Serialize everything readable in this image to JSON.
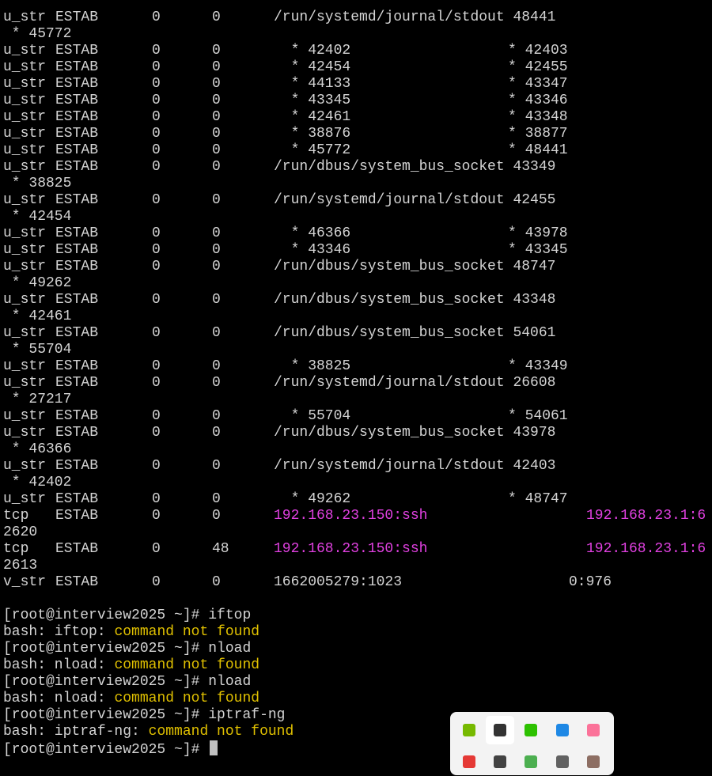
{
  "terminal": {
    "rows": [
      {
        "cols": [
          "u_str",
          "ESTAB",
          "0",
          "0",
          "/run/systemd/journal/stdout 48441"
        ]
      },
      {
        "cols": [
          " * 45772"
        ]
      },
      {
        "cols": [
          "u_str",
          "ESTAB",
          "0",
          "0",
          "  * 42402",
          "* 42403"
        ]
      },
      {
        "cols": [
          "u_str",
          "ESTAB",
          "0",
          "0",
          "  * 42454",
          "* 42455"
        ]
      },
      {
        "cols": [
          "u_str",
          "ESTAB",
          "0",
          "0",
          "  * 44133",
          "* 43347"
        ]
      },
      {
        "cols": [
          "u_str",
          "ESTAB",
          "0",
          "0",
          "  * 43345",
          "* 43346"
        ]
      },
      {
        "cols": [
          "u_str",
          "ESTAB",
          "0",
          "0",
          "  * 42461",
          "* 43348"
        ]
      },
      {
        "cols": [
          "u_str",
          "ESTAB",
          "0",
          "0",
          "  * 38876",
          "* 38877"
        ]
      },
      {
        "cols": [
          "u_str",
          "ESTAB",
          "0",
          "0",
          "  * 45772",
          "* 48441"
        ]
      },
      {
        "cols": [
          "u_str",
          "ESTAB",
          "0",
          "0",
          "/run/dbus/system_bus_socket 43349"
        ]
      },
      {
        "cols": [
          " * 38825"
        ]
      },
      {
        "cols": [
          "u_str",
          "ESTAB",
          "0",
          "0",
          "/run/systemd/journal/stdout 42455"
        ]
      },
      {
        "cols": [
          " * 42454"
        ]
      },
      {
        "cols": [
          "u_str",
          "ESTAB",
          "0",
          "0",
          "  * 46366",
          "* 43978"
        ]
      },
      {
        "cols": [
          "u_str",
          "ESTAB",
          "0",
          "0",
          "  * 43346",
          "* 43345"
        ]
      },
      {
        "cols": [
          "u_str",
          "ESTAB",
          "0",
          "0",
          "/run/dbus/system_bus_socket 48747"
        ]
      },
      {
        "cols": [
          " * 49262"
        ]
      },
      {
        "cols": [
          "u_str",
          "ESTAB",
          "0",
          "0",
          "/run/dbus/system_bus_socket 43348"
        ]
      },
      {
        "cols": [
          " * 42461"
        ]
      },
      {
        "cols": [
          "u_str",
          "ESTAB",
          "0",
          "0",
          "/run/dbus/system_bus_socket 54061"
        ]
      },
      {
        "cols": [
          " * 55704"
        ]
      },
      {
        "cols": [
          "u_str",
          "ESTAB",
          "0",
          "0",
          "  * 38825",
          "* 43349"
        ]
      },
      {
        "cols": [
          "u_str",
          "ESTAB",
          "0",
          "0",
          "/run/systemd/journal/stdout 26608"
        ]
      },
      {
        "cols": [
          " * 27217"
        ]
      },
      {
        "cols": [
          "u_str",
          "ESTAB",
          "0",
          "0",
          "  * 55704",
          "* 54061"
        ]
      },
      {
        "cols": [
          "u_str",
          "ESTAB",
          "0",
          "0",
          "/run/dbus/system_bus_socket 43978"
        ]
      },
      {
        "cols": [
          " * 46366"
        ]
      },
      {
        "cols": [
          "u_str",
          "ESTAB",
          "0",
          "0",
          "/run/systemd/journal/stdout 42403"
        ]
      },
      {
        "cols": [
          " * 42402"
        ]
      },
      {
        "cols": [
          "u_str",
          "ESTAB",
          "0",
          "0",
          "  * 49262",
          "* 48747"
        ]
      },
      {
        "cols": [
          "tcp",
          "ESTAB",
          "0",
          "0",
          "192.168.23.150:ssh",
          "192.168.23.1:6"
        ],
        "ip": true
      },
      {
        "cols": [
          "2620"
        ]
      },
      {
        "cols": [
          "tcp",
          "ESTAB",
          "0",
          "48",
          "192.168.23.150:ssh",
          "192.168.23.1:6"
        ],
        "ip": true
      },
      {
        "cols": [
          "2613"
        ]
      },
      {
        "cols": [
          "v_str",
          "ESTAB",
          "0",
          "0",
          "1662005279:1023",
          "0:976"
        ],
        "vsock": true
      },
      {
        "cols": [
          ""
        ]
      }
    ],
    "session": [
      {
        "prompt": "[root@interview2025 ~]#",
        "cmd": " iftop"
      },
      {
        "err_prefix": "bash: iftop: ",
        "err_msg": "command not found"
      },
      {
        "prompt": "[root@interview2025 ~]#",
        "cmd": " nload"
      },
      {
        "err_prefix": "bash: nload: ",
        "err_msg": "command not found"
      },
      {
        "prompt": "[root@interview2025 ~]#",
        "cmd": " nload"
      },
      {
        "err_prefix": "bash: nload: ",
        "err_msg": "command not found"
      },
      {
        "prompt": "[root@interview2025 ~]#",
        "cmd": " iptraf-ng"
      },
      {
        "err_prefix": "bash: iptraf-ng: ",
        "err_msg": "command not found"
      },
      {
        "prompt": "[root@interview2025 ~]#",
        "cmd": " ",
        "cursor": true
      }
    ],
    "colors": {
      "background": "#000000",
      "text": "#d4d4d4",
      "ip": "#e040e0",
      "error": "#e0c000"
    }
  },
  "tray": {
    "icons": [
      {
        "name": "nvidia-icon",
        "color": "#76b900"
      },
      {
        "name": "pen-tool-icon",
        "color": "#333333"
      },
      {
        "name": "wechat-icon",
        "color": "#2dc100"
      },
      {
        "name": "network-app-icon",
        "color": "#1e88e5"
      },
      {
        "name": "bilibili-icon",
        "color": "#fb7299"
      },
      {
        "name": "red-app-icon",
        "color": "#e53935"
      },
      {
        "name": "dark-app-icon",
        "color": "#424242"
      },
      {
        "name": "chrome-icon",
        "color": "#4caf50"
      },
      {
        "name": "usb-icon",
        "color": "#616161"
      },
      {
        "name": "grid-app-icon",
        "color": "#8d6e63"
      }
    ]
  }
}
